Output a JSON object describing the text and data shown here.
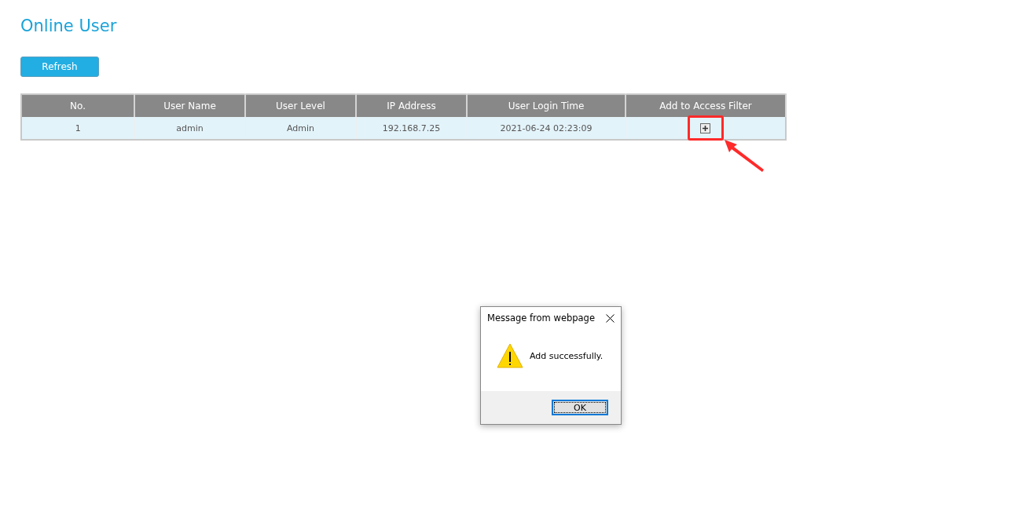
{
  "page": {
    "title": "Online User"
  },
  "refresh_button": {
    "label": "Refresh"
  },
  "table": {
    "columns": [
      "No.",
      "User Name",
      "User Level",
      "IP Address",
      "User Login Time",
      "Add to Access Filter"
    ],
    "rows": [
      {
        "cells": [
          "1",
          "admin",
          "Admin",
          "192.168.7.25",
          "2021-06-24 02:23:09"
        ],
        "highlighted": true
      }
    ]
  },
  "dialog": {
    "title": "Message from webpage",
    "message": "Add successfully.",
    "button": "OK"
  }
}
